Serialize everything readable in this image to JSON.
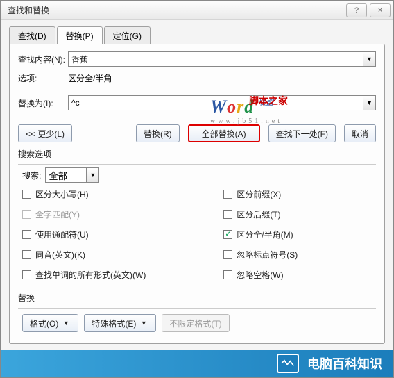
{
  "window": {
    "title": "查找和替换",
    "help_label": "?",
    "close_label": "×"
  },
  "tabs": [
    {
      "label": "查找(D)",
      "key": "D"
    },
    {
      "label": "替换(P)",
      "key": "P"
    },
    {
      "label": "定位(G)",
      "key": "G"
    }
  ],
  "active_tab": 1,
  "fields": {
    "find_label": "查找内容(N):",
    "find_value": "香蕉",
    "options_label": "选项:",
    "options_value": "区分全/半角",
    "replace_label": "替换为(I):",
    "replace_value": "^c"
  },
  "buttons": {
    "less": "<< 更少(L)",
    "replace": "替换(R)",
    "replace_all": "全部替换(A)",
    "find_next": "查找下一处(F)",
    "cancel": "取消"
  },
  "search_options": {
    "section_label": "搜索选项",
    "search_label": "搜索:",
    "search_value": "全部",
    "left": [
      {
        "label": "区分大小写(H)",
        "checked": false,
        "disabled": false
      },
      {
        "label": "全字匹配(Y)",
        "checked": false,
        "disabled": true
      },
      {
        "label": "使用通配符(U)",
        "checked": false,
        "disabled": false
      },
      {
        "label": "同音(英文)(K)",
        "checked": false,
        "disabled": false
      },
      {
        "label": "查找单词的所有形式(英文)(W)",
        "checked": false,
        "disabled": false
      }
    ],
    "right": [
      {
        "label": "区分前缀(X)",
        "checked": false,
        "disabled": false
      },
      {
        "label": "区分后缀(T)",
        "checked": false,
        "disabled": false
      },
      {
        "label": "区分全/半角(M)",
        "checked": true,
        "disabled": false
      },
      {
        "label": "忽略标点符号(S)",
        "checked": false,
        "disabled": false
      },
      {
        "label": "忽略空格(W)",
        "checked": false,
        "disabled": false
      }
    ]
  },
  "replace_section": {
    "label": "替换",
    "format": "格式(O)",
    "special": "特殊格式(E)",
    "no_format": "不限定格式(T)"
  },
  "watermark": {
    "chinese": "脚本之家",
    "url": "www.jb51.net"
  },
  "footer": {
    "text": "电脑百科知识"
  }
}
